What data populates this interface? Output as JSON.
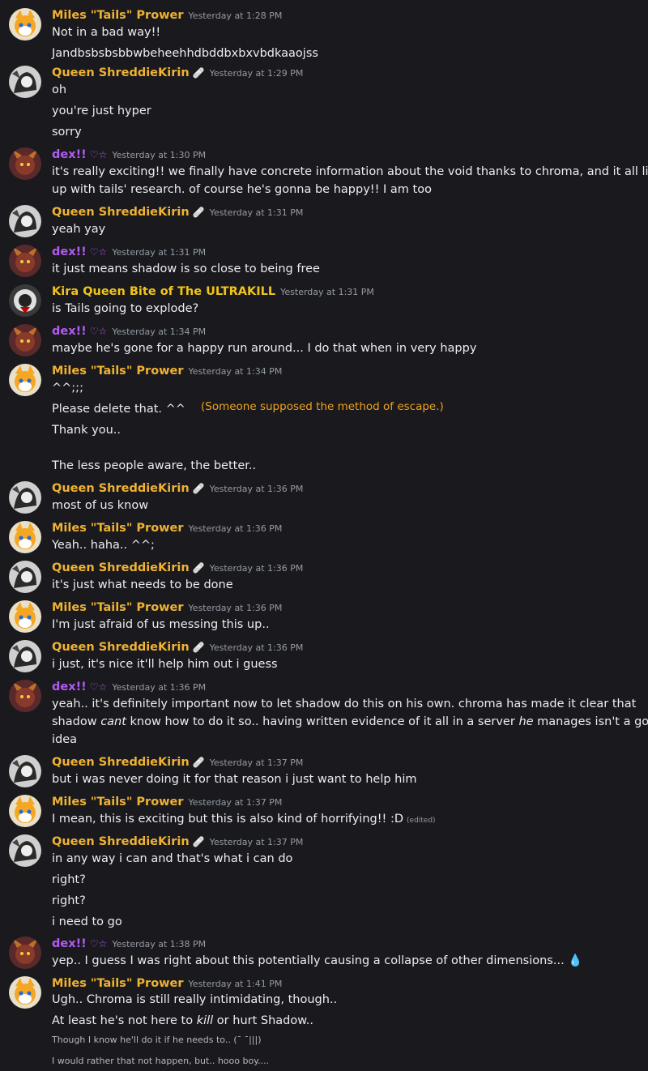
{
  "users": {
    "tails": {
      "name": "Miles \"Tails\" Prower",
      "color": "#f0b232"
    },
    "queen": {
      "name": "Queen ShreddieKirin",
      "badge": "🩹",
      "color": "#f0b232"
    },
    "dex": {
      "name": "dex!!",
      "badge": "♡☆",
      "color": "#b35bf3"
    },
    "kira": {
      "name": "Kira Queen Bite of The ULTRAKILL",
      "color": "#f0c419"
    }
  },
  "messages": [
    {
      "author": "Miles \"Tails\" Prower",
      "time": "Yesterday at 1:28 PM",
      "lines": [
        "Not in a bad way!!",
        "Jandbsbsbsbbwbeheehhdbddbxbxvbdkaaojss"
      ]
    },
    {
      "author": "Queen ShreddieKirin",
      "time": "Yesterday at 1:29 PM",
      "lines": [
        "oh",
        "you're just hyper",
        "sorry"
      ]
    },
    {
      "author": "dex!!",
      "time": "Yesterday at 1:30 PM",
      "lines": [
        "it's really exciting!! we finally have concrete information about the void thanks to chroma, and it all lines",
        "up with tails' research. of course he's gonna be happy!! I am too"
      ]
    },
    {
      "author": "Queen ShreddieKirin",
      "time": "Yesterday at 1:31 PM",
      "lines": [
        "yeah yay"
      ]
    },
    {
      "author": "dex!!",
      "time": "Yesterday at 1:31 PM",
      "lines": [
        "it just means shadow is so close to being free"
      ]
    },
    {
      "author": "Kira Queen Bite of The ULTRAKILL",
      "time": "Yesterday at 1:31 PM",
      "lines": [
        "is Tails going to explode?"
      ]
    },
    {
      "author": "dex!!",
      "time": "Yesterday at 1:34 PM",
      "lines": [
        "maybe he's gone for a happy run around... I do that when in very happy"
      ]
    },
    {
      "author": "Miles \"Tails\" Prower",
      "time": "Yesterday at 1:34 PM",
      "lines": [
        "^^;;;",
        "Please delete that. ^^",
        "Thank you..",
        "The less people aware, the better.."
      ],
      "note": "(Someone supposed the method of escape.)"
    },
    {
      "author": "Queen ShreddieKirin",
      "time": "Yesterday at 1:36 PM",
      "lines": [
        "most of us know"
      ]
    },
    {
      "author": "Miles \"Tails\" Prower",
      "time": "Yesterday at 1:36 PM",
      "lines": [
        "Yeah.. haha.. ^^;"
      ]
    },
    {
      "author": "Queen ShreddieKirin",
      "time": "Yesterday at 1:36 PM",
      "lines": [
        "it's just what needs to be done"
      ]
    },
    {
      "author": "Miles \"Tails\" Prower",
      "time": "Yesterday at 1:36 PM",
      "lines": [
        "I'm just afraid of us messing this up.."
      ]
    },
    {
      "author": "Queen ShreddieKirin",
      "time": "Yesterday at 1:36 PM",
      "lines": [
        "i just, it's nice it'll help him out i guess"
      ]
    },
    {
      "author": "dex!!",
      "time": "Yesterday at 1:36 PM",
      "lines": [
        "yeah.. it's definitely important now to let shadow do this on his own. chroma has made it clear that",
        "shadow ",
        "cant",
        " know how to do it so.. having written evidence of it all in a server ",
        "he",
        " manages isn't a good",
        "idea"
      ]
    },
    {
      "author": "Queen ShreddieKirin",
      "time": "Yesterday at 1:37 PM",
      "lines": [
        "but i was never doing it for that reason i just want to help him"
      ]
    },
    {
      "author": "Miles \"Tails\" Prower",
      "time": "Yesterday at 1:37 PM",
      "lines": [
        "I mean, this is exciting but this is also kind of horrifying!! :D"
      ],
      "edited": "(edited)"
    },
    {
      "author": "Queen ShreddieKirin",
      "time": "Yesterday at 1:37 PM",
      "lines": [
        "in any way i can and that's what i can do",
        "right?",
        "right?",
        "i need to go"
      ]
    },
    {
      "author": "dex!!",
      "time": "Yesterday at 1:38 PM",
      "lines": [
        "yep.. I guess I was right about this potentially causing a collapse of other dimensions... ",
        "💧"
      ]
    },
    {
      "author": "Miles \"Tails\" Prower",
      "time": "Yesterday at 1:41 PM",
      "lines": [
        "Ugh.. Chroma is still really intimidating, though..",
        "At least he's not here to ",
        "kill",
        " or hurt Shadow..",
        "Though I know he'll do it if he needs to.. (¯ ¯|||)",
        "I would rather that not happen, but.. hooo boy...."
      ]
    }
  ]
}
